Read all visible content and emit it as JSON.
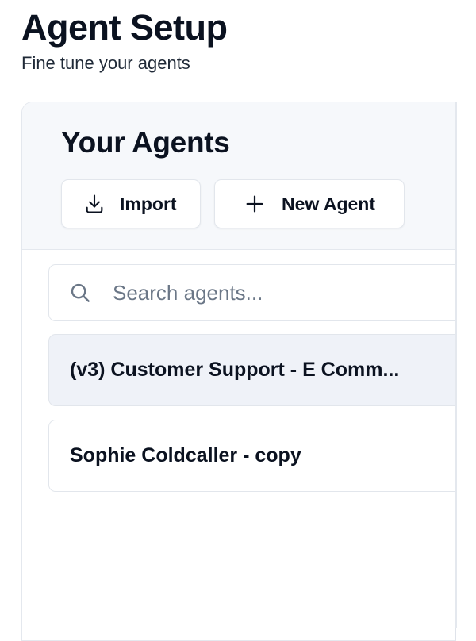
{
  "header": {
    "title": "Agent Setup",
    "subtitle": "Fine tune your agents"
  },
  "panel": {
    "title": "Your Agents",
    "buttons": {
      "import_label": "Import",
      "import_icon": "download-icon",
      "new_agent_label": "New Agent",
      "new_agent_icon": "plus-icon"
    },
    "search": {
      "placeholder": "Search agents...",
      "value": "",
      "icon": "search-icon"
    },
    "agents": [
      {
        "label": "(v3) Customer Support - E Comm...",
        "selected": true
      },
      {
        "label": "Sophie Coldcaller - copy",
        "selected": false
      }
    ]
  },
  "colors": {
    "text_primary": "#0b1220",
    "panel_header_bg": "#f6f8fb",
    "selected_item_bg": "#eff2f8",
    "border": "#e2e6ec",
    "placeholder": "#6b7787"
  }
}
